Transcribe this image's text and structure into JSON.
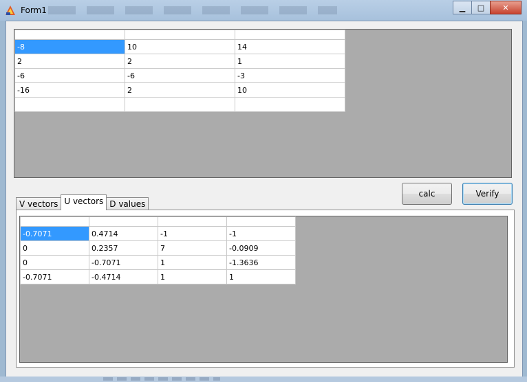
{
  "window": {
    "title": "Form1",
    "minimize_glyph": "▁",
    "maximize_glyph": "□",
    "close_glyph": "✕"
  },
  "top_grid": {
    "rows": [
      [
        "-8",
        "10",
        "14"
      ],
      [
        "2",
        "2",
        "1"
      ],
      [
        "-6",
        "-6",
        "-3"
      ],
      [
        "-16",
        "2",
        "10"
      ],
      [
        "",
        "",
        ""
      ]
    ]
  },
  "buttons": {
    "calc": "calc",
    "verify": "Verify"
  },
  "tabs": [
    {
      "label": "V vectors",
      "active": false
    },
    {
      "label": "U vectors",
      "active": true
    },
    {
      "label": "D values",
      "active": false
    }
  ],
  "bottom_grid": {
    "rows": [
      [
        "-0.7071",
        "0.4714",
        "-1",
        "-1"
      ],
      [
        "0",
        "0.2357",
        "7",
        "-0.0909"
      ],
      [
        "0",
        "-0.7071",
        "1",
        "-1.3636"
      ],
      [
        "-0.7071",
        "-0.4714",
        "1",
        "1"
      ]
    ]
  },
  "colors": {
    "selection": "#3399ff",
    "grid_background": "#ababab"
  }
}
